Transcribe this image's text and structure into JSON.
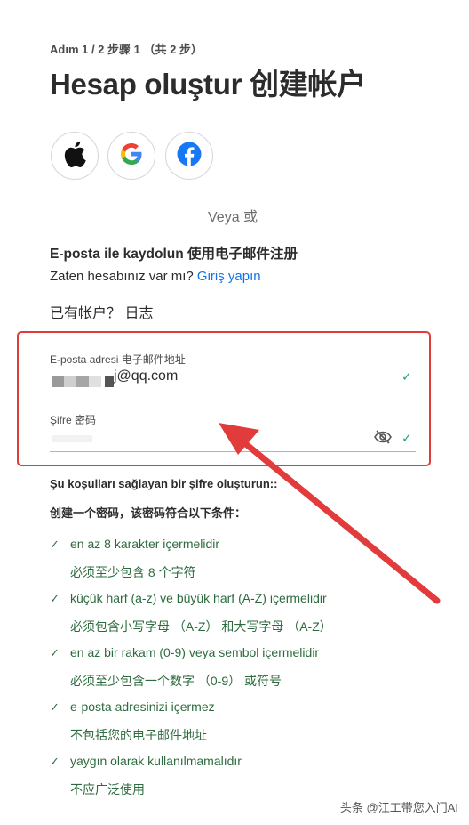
{
  "header": {
    "step": "Adım 1 / 2 步骤 1 （共 2 步）",
    "title": "Hesap oluştur 创建帐户"
  },
  "social": {
    "icons": [
      "apple-icon",
      "google-icon",
      "facebook-icon"
    ],
    "google_letter": "G",
    "facebook_letter": "f"
  },
  "divider": {
    "label": "Veya 或"
  },
  "signup": {
    "heading": "E-posta ile kaydolun 使用电子邮件注册",
    "have_account": "Zaten hesabınız var mı?",
    "sign_in_link": "Giriş yapın",
    "have_account_cn": "已有帐户？ 日志"
  },
  "form": {
    "email_label": "E-posta adresi 电子邮件地址",
    "email_value": "j@qq.com",
    "password_label": "Şifre 密码",
    "check_mark": "✓"
  },
  "conditions": {
    "title": "Şu koşulları sağlayan bir şifre oluşturun::",
    "title_cn": "创建一个密码，该密码符合以下条件：",
    "check_mark": "✓",
    "rules": [
      {
        "text": "en az 8 karakter içermelidir",
        "cn": "必须至少包含 8 个字符"
      },
      {
        "text": "küçük harf (a-z) ve büyük harf (A-Z) içermelidir",
        "cn": "必须包含小写字母 （A-Z） 和大写字母 （A-Z）"
      },
      {
        "text": "en az bir rakam (0-9) veya sembol içermelidir",
        "cn": "必须至少包含一个数字 （0-9） 或符号"
      },
      {
        "text": "e-posta adresinizi içermez",
        "cn": "不包括您的电子邮件地址"
      },
      {
        "text": "yaygın olarak kullanılmamalıdır",
        "cn": "不应广泛使用"
      }
    ]
  },
  "watermark": "头条 @江工带您入门AI",
  "colors": {
    "accent": "#1473e6",
    "check": "#2d9d78",
    "annotation": "#e23b3b",
    "rule_text": "#2d6b3e"
  }
}
